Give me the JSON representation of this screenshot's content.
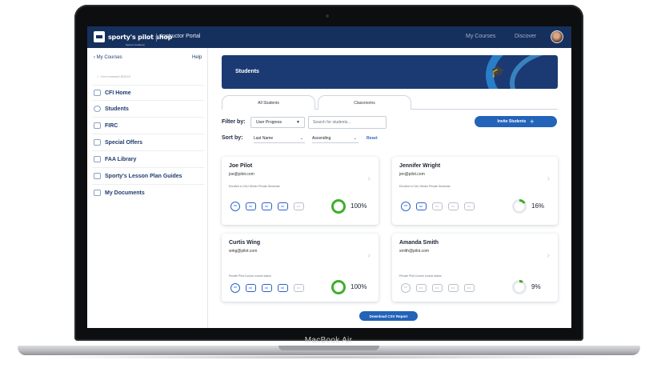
{
  "device": {
    "label": "MacBook Air"
  },
  "topbar": {
    "logo_text": "sporty's pilot shop",
    "logo_sub": "Sporty's Academy",
    "portal_title": "Instructor Portal",
    "nav": [
      "My Courses",
      "Discover"
    ]
  },
  "sidebar": {
    "back_label": "My Courses",
    "help_label": "Help",
    "cert_status": "Cert renewed 8/2023",
    "items": [
      {
        "label": "CFI Home",
        "icon": "home-icon"
      },
      {
        "label": "Students",
        "icon": "graduation-cap-icon"
      },
      {
        "label": "FIRC",
        "icon": "certificate-icon"
      },
      {
        "label": "Special Offers",
        "icon": "ticket-icon"
      },
      {
        "label": "FAA Library",
        "icon": "book-icon"
      },
      {
        "label": "Sporty's Lesson Plan Guides",
        "icon": "book-icon"
      },
      {
        "label": "My Documents",
        "icon": "document-icon"
      }
    ]
  },
  "main": {
    "banner_title": "Students",
    "tabs": [
      "All Students",
      "Classrooms"
    ],
    "filter_label": "Filter by:",
    "filter_value": "User Progress",
    "search_placeholder": "Search for students...",
    "sort_label": "Sort by:",
    "sort_value": "Last Name",
    "order_value": "Ascending",
    "reset_label": "Reset",
    "invite_label": "Invite Students",
    "csv_label": "Download CSV Report",
    "colors": {
      "brand_navy": "#16305d",
      "accent_blue": "#2363b8",
      "progress_green": "#3fae2a"
    }
  },
  "students": [
    {
      "name": "Joe Pilot",
      "email": "joe@pilot.com",
      "note": "Enrolled in CAU Winter Private Semester",
      "progress_label": "100%",
      "progress": 1.0
    },
    {
      "name": "Jennifer Wright",
      "email": "jen@pilot.com",
      "note": "Enrolled in CAU Winter Private Semester",
      "progress_label": "16%",
      "progress": 0.16
    },
    {
      "name": "Curtis Wing",
      "email": "wing@pilot.com",
      "note": "Private Pilot Course course status",
      "progress_label": "100%",
      "progress": 1.0
    },
    {
      "name": "Amanda Smith",
      "email": "smith@pilot.com",
      "note": "Private Pilot Course course status",
      "progress_label": "9%",
      "progress": 0.09
    }
  ]
}
